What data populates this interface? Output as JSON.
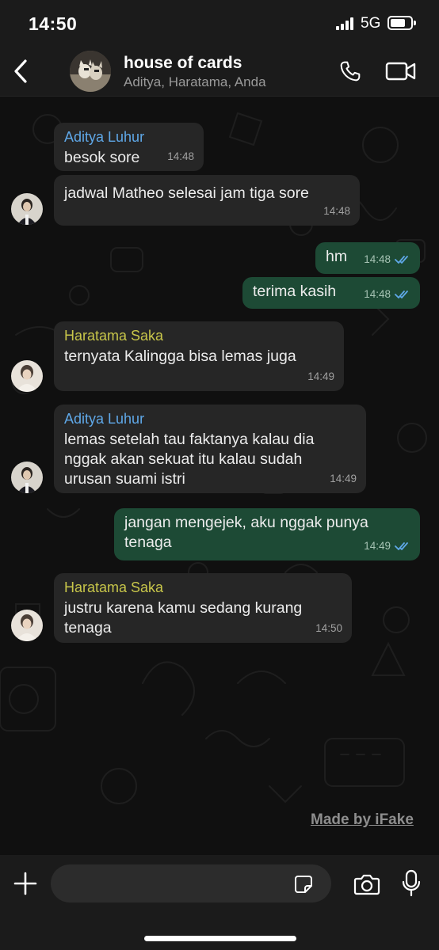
{
  "status_bar": {
    "time": "14:50",
    "network": "5G"
  },
  "header": {
    "title": "house of cards",
    "subtitle": "Aditya, Haratama, Anda",
    "back_icon": "chevron-left-icon",
    "call_icon": "phone-icon",
    "video_icon": "video-camera-icon"
  },
  "colors": {
    "incoming_bubble": "#262626",
    "outgoing_bubble": "#1d4a35",
    "aditya_name": "#5fa8e8",
    "haratama_name": "#c8c64a",
    "read_ticks": "#5fa8e8"
  },
  "messages": [
    {
      "direction": "in",
      "sender": "Aditya Luhur",
      "text": "besok sore",
      "time": "14:48"
    },
    {
      "direction": "in",
      "sender": "",
      "text": "jadwal Matheo selesai jam tiga sore",
      "time": "14:48"
    },
    {
      "direction": "out",
      "text": "hm",
      "time": "14:48",
      "status": "read"
    },
    {
      "direction": "out",
      "text": "terima kasih",
      "time": "14:48",
      "status": "read"
    },
    {
      "direction": "in",
      "sender": "Haratama Saka",
      "text": "ternyata Kalingga bisa lemas juga",
      "time": "14:49"
    },
    {
      "direction": "in",
      "sender": "Aditya Luhur",
      "text": "lemas setelah tau faktanya kalau dia\nnggak akan sekuat itu kalau sudah\nurusan suami istri",
      "time": "14:49"
    },
    {
      "direction": "out",
      "text": "jangan mengejek, aku nggak punya\ntenaga",
      "time": "14:49",
      "status": "read"
    },
    {
      "direction": "in",
      "sender": "Haratama Saka",
      "text": "justru karena kamu sedang kurang\ntenaga",
      "time": "14:50"
    }
  ],
  "watermark": "Made by iFake",
  "input_bar": {
    "placeholder": "",
    "plus_icon": "plus-icon",
    "sticker_icon": "sticker-icon",
    "camera_icon": "camera-icon",
    "mic_icon": "microphone-icon"
  }
}
